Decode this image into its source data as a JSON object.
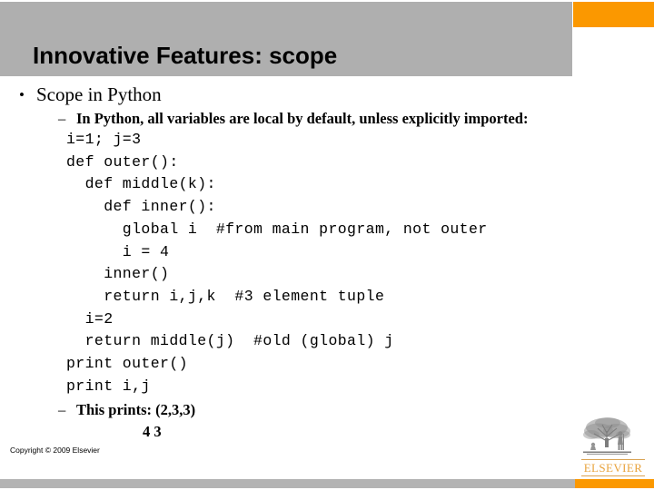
{
  "slide": {
    "title": "Innovative Features: scope",
    "accent_gray": "#afafaf",
    "accent_orange": "#fb9800"
  },
  "body": {
    "bullet_glyph": "•",
    "dash_glyph": "–",
    "level1": "Scope in Python",
    "level2": "In Python, all variables are local by default, unless explicitly imported:",
    "code": [
      "i=1; j=3",
      "def outer():",
      "  def middle(k):",
      "    def inner():",
      "      global i  #from main program, not outer",
      "      i = 4",
      "    inner()",
      "    return i,j,k  #3 element tuple",
      "  i=2",
      "  return middle(j)  #old (global) j",
      "print outer()",
      "print i,j"
    ],
    "result_label": "This prints: (2,3,3)",
    "result_second_line": "4 3"
  },
  "footer": {
    "copyright": "Copyright © 2009 Elsevier",
    "logo_word": "ELSEVIER"
  }
}
